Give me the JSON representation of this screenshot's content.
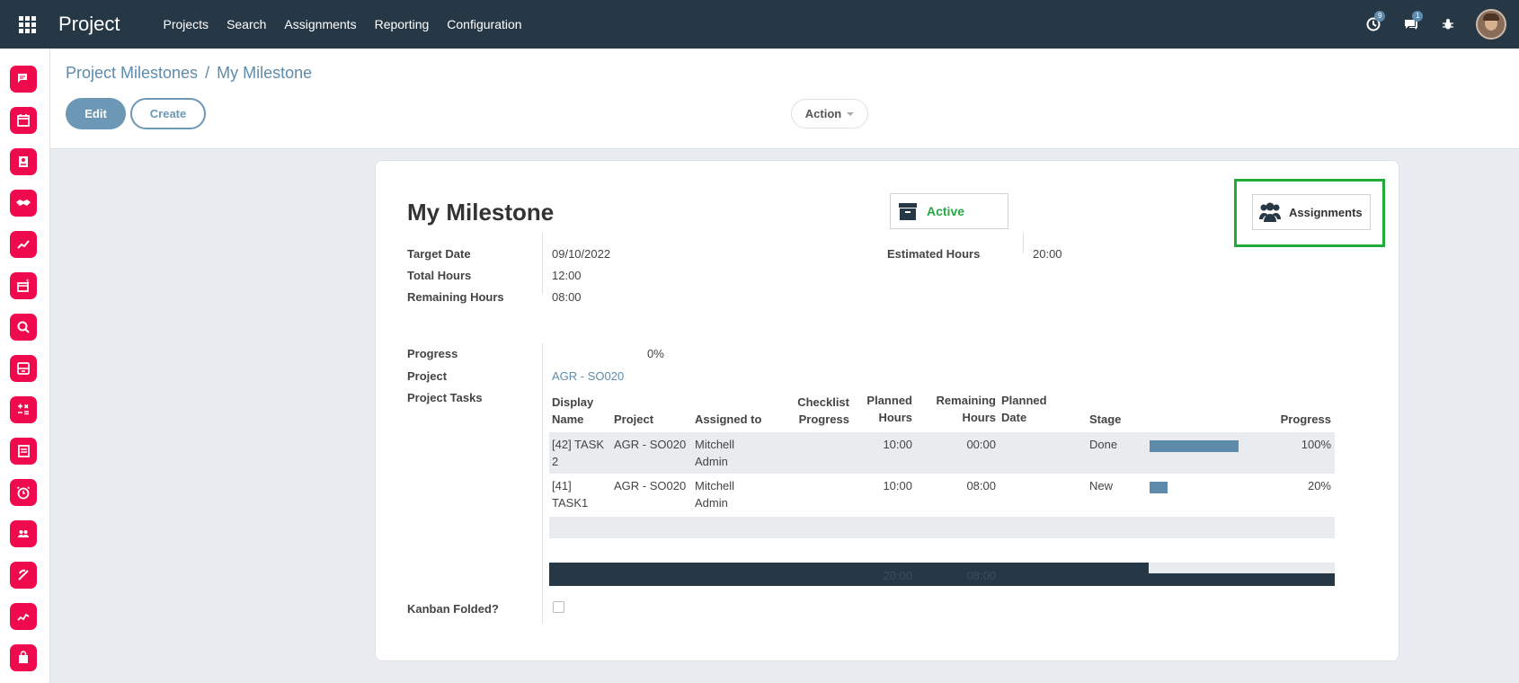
{
  "navbar": {
    "brand": "Project",
    "menu": [
      "Projects",
      "Search",
      "Assignments",
      "Reporting",
      "Configuration"
    ],
    "activity_badge": "9",
    "messages_badge": "1"
  },
  "sidebar": {
    "icons": [
      "discuss-icon",
      "calendar-icon",
      "contacts-icon",
      "crm-handshake-icon",
      "sales-chart-icon",
      "invoicing-icon",
      "search-magnify-icon",
      "dashboard-icon",
      "accounting-calculator-icon",
      "documents-icon",
      "timesheet-clock-icon",
      "employees-icon",
      "expenses-icon",
      "analytics-icon",
      "shop-bag-icon"
    ]
  },
  "breadcrumb": {
    "parent": "Project Milestones",
    "separator": "/",
    "current": "My Milestone"
  },
  "buttons": {
    "edit": "Edit",
    "create": "Create",
    "action": "Action"
  },
  "form": {
    "title": "My Milestone",
    "active_label": "Active",
    "assignments_label": "Assignments",
    "fields": {
      "target_date_label": "Target Date",
      "target_date": "09/10/2022",
      "total_hours_label": "Total Hours",
      "total_hours": "12:00",
      "remaining_hours_label": "Remaining Hours",
      "remaining_hours": "08:00",
      "estimated_hours_label": "Estimated Hours",
      "estimated_hours": "20:00",
      "progress_label": "Progress",
      "progress": "0%",
      "project_label": "Project",
      "project": "AGR - SO020",
      "project_tasks_label": "Project Tasks",
      "kanban_folded_label": "Kanban Folded?"
    },
    "tasks": {
      "headers": {
        "display_name": [
          "Display",
          "Name"
        ],
        "project": "Project",
        "assigned_to": "Assigned to",
        "checklist": [
          "Checklist",
          "Progress"
        ],
        "planned": [
          "Planned",
          "Hours"
        ],
        "remaining": [
          "Remaining",
          "Hours"
        ],
        "planned_date": [
          "Planned",
          "Date"
        ],
        "stage": "Stage",
        "progress": "Progress"
      },
      "rows": [
        {
          "name": [
            "[42] TASK",
            "2"
          ],
          "project": "AGR - SO020",
          "assigned": [
            "Mitchell",
            "Admin"
          ],
          "planned": "10:00",
          "remaining": "00:00",
          "stage": "Done",
          "progress_value": 1.0,
          "progress": "100%"
        },
        {
          "name": [
            "[41]",
            "TASK1"
          ],
          "project": "AGR - SO020",
          "assigned": [
            "Mitchell",
            "Admin"
          ],
          "planned": "10:00",
          "remaining": "08:00",
          "stage": "New",
          "progress_value": 0.2,
          "progress": "20%"
        }
      ],
      "totals": {
        "planned": "20:00",
        "remaining": "08:00"
      }
    }
  }
}
